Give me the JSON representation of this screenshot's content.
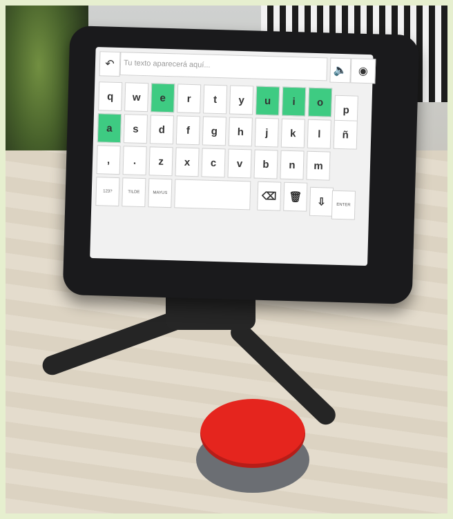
{
  "photo": {
    "subject": "tablet-communicator-with-red-switch"
  },
  "tablet": {
    "placeholder": "Tu texto aparecerá aquí...",
    "icons": {
      "back": "↶",
      "speaker": "🔈",
      "eye": "◉",
      "backspace": "⌫",
      "trash": "🗑",
      "download": "⇩"
    },
    "rows": [
      [
        "q",
        "w",
        "e",
        "r",
        "t",
        "y",
        "u",
        "i",
        "o"
      ],
      [
        "a",
        "s",
        "d",
        "f",
        "g",
        "h",
        "j",
        "k",
        "l",
        "ñ"
      ],
      [
        ",",
        ".",
        "z",
        "x",
        "c",
        "v",
        "b",
        "n",
        "m"
      ]
    ],
    "row1_extra": "p",
    "highlighted": [
      "e",
      "u",
      "i",
      "o",
      "a"
    ],
    "controls": [
      "123?",
      "TILDE",
      "MAYUS",
      "ENTER"
    ]
  }
}
